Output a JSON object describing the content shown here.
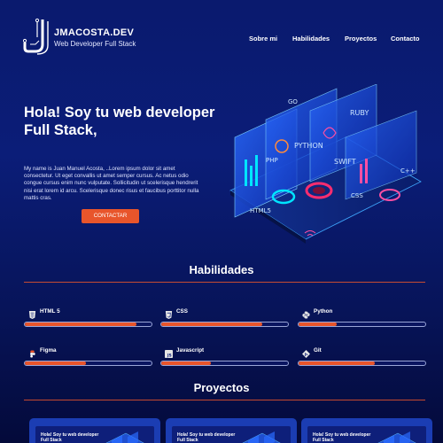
{
  "brand": {
    "name": "JMACOSTA.DEV",
    "subtitle": "Web Developer Full Stack"
  },
  "nav": {
    "items": [
      "Sobre mi",
      "Habilidades",
      "Proyectos",
      "Contacto"
    ]
  },
  "hero": {
    "title": "Hola! Soy tu web developer Full Stack,",
    "description": "My name is Juan Manuel Acosta, ..Lorem ipsum dolor sit amet consectetur. Ut eget convallis ut amet semper cursus. Ac netus odio congue cursus enim nunc vulputate. Sollicitudin ut scelerisque hendrerit nisi erat lorem id arcu. Scelerisque donec risus et faucibus porttitor nulla mattis cras.",
    "cta_label": "CONTACTAR",
    "illustration_labels": [
      "GO",
      "RUBY",
      "PYTHON",
      "SWIFT",
      "PHP",
      "C++",
      "CSS",
      "HTML5"
    ]
  },
  "skills": {
    "title": "Habilidades",
    "items": [
      {
        "name": "HTML 5",
        "icon": "html5-icon",
        "level": 0.88
      },
      {
        "name": "CSS",
        "icon": "css3-icon",
        "level": 0.8
      },
      {
        "name": "Python",
        "icon": "python-icon",
        "level": 0.3
      },
      {
        "name": "Figma",
        "icon": "figma-icon",
        "level": 0.48
      },
      {
        "name": "Javascript",
        "icon": "javascript-icon",
        "level": 0.39
      },
      {
        "name": "Git",
        "icon": "git-icon",
        "level": 0.6
      }
    ]
  },
  "projects": {
    "title": "Proyectos",
    "cards": [
      {
        "title": "Hola! Soy tu web developer Full Stack"
      },
      {
        "title": "Hola! Soy tu web developer Full Stack"
      },
      {
        "title": "Hola! Soy tu web developer Full Stack"
      }
    ]
  },
  "colors": {
    "accent": "#e8552b",
    "background": "#0b1d78",
    "card": "#1b3db3"
  }
}
